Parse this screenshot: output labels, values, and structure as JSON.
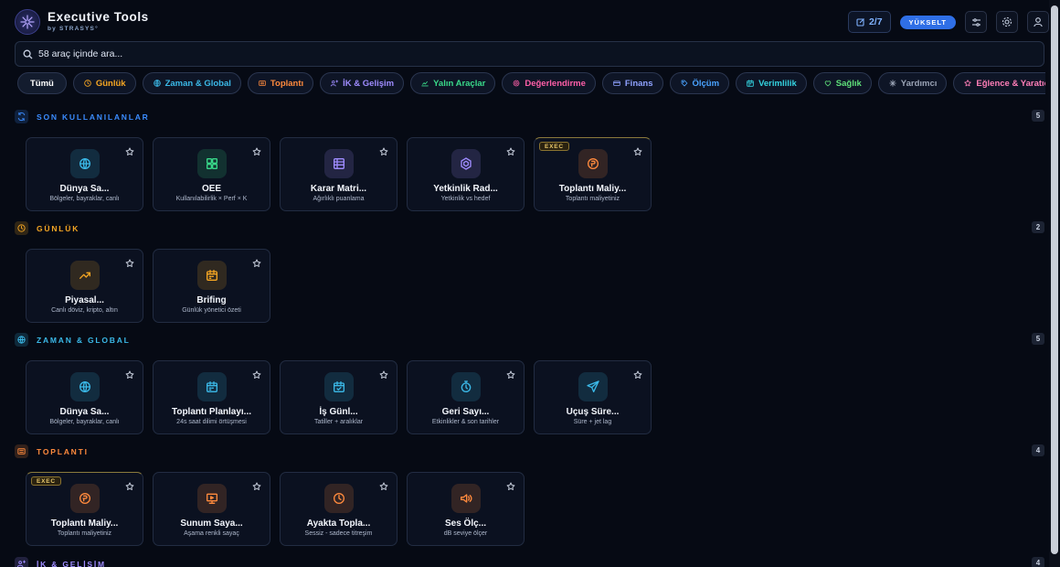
{
  "header": {
    "title": "Executive Tools",
    "subtitle": "by STRASYS°",
    "quota": "2/7",
    "upgrade_label": "YÜKSELT"
  },
  "search": {
    "placeholder": "58 araç içinde ara..."
  },
  "filters": [
    {
      "label": "Tümü",
      "color": "#ffffff",
      "icon": "none"
    },
    {
      "label": "Günlük",
      "color": "#f5a623",
      "icon": "clock-icon"
    },
    {
      "label": "Zaman & Global",
      "color": "#3bb9e8",
      "icon": "globe-icon"
    },
    {
      "label": "Toplantı",
      "color": "#ff8a3d",
      "icon": "meeting-icon"
    },
    {
      "label": "İK & Gelişim",
      "color": "#9f8cff",
      "icon": "people-icon"
    },
    {
      "label": "Yalın Araçlar",
      "color": "#39d98a",
      "icon": "chart-icon"
    },
    {
      "label": "Değerlendirme",
      "color": "#ff5fa8",
      "icon": "gear-icon"
    },
    {
      "label": "Finans",
      "color": "#8fa2ff",
      "icon": "wallet-icon"
    },
    {
      "label": "Ölçüm",
      "color": "#4aa3ff",
      "icon": "tag-icon"
    },
    {
      "label": "Verimlilik",
      "color": "#34d3e0",
      "icon": "calendar-icon"
    },
    {
      "label": "Sağlık",
      "color": "#5fe07a",
      "icon": "heart-icon"
    },
    {
      "label": "Yardımcı",
      "color": "#9aa3b5",
      "icon": "sparkle-icon"
    },
    {
      "label": "Eğlence & Yaratıcı",
      "color": "#ff7eb8",
      "icon": "star-icon"
    }
  ],
  "sections": [
    {
      "title": "SON KULLANILANLAR",
      "count": "5",
      "color": "#3b8cff",
      "icon": "refresh-icon",
      "tools": [
        {
          "name": "Dünya Sa...",
          "desc": "Bölgeler, bayraklar, canlı",
          "icon": "globe-icon",
          "color": "#3bb9e8",
          "exec": false
        },
        {
          "name": "OEE",
          "desc": "Kullanılabilirlik × Perf × K",
          "icon": "grid-icon",
          "color": "#39d98a",
          "exec": false
        },
        {
          "name": "Karar Matri...",
          "desc": "Ağırlıklı puanlama",
          "icon": "table-icon",
          "color": "#9f8cff",
          "exec": false
        },
        {
          "name": "Yetkinlik Rad...",
          "desc": "Yetkinlik vs hedef",
          "icon": "hexagon-icon",
          "color": "#9f8cff",
          "exec": false
        },
        {
          "name": "Toplantı Maliy...",
          "desc": "Toplantı maliyetiniz",
          "icon": "coin-icon",
          "color": "#ff8a3d",
          "exec": true
        }
      ]
    },
    {
      "title": "GÜNLÜK",
      "count": "2",
      "color": "#f5a623",
      "icon": "clock-icon",
      "tools": [
        {
          "name": "Piyasal...",
          "desc": "Canlı döviz, kripto, altın",
          "icon": "trend-icon",
          "color": "#f5a623",
          "exec": false
        },
        {
          "name": "Brifing",
          "desc": "Günlük yönetici özeti",
          "icon": "calendar-icon",
          "color": "#f5a623",
          "exec": false
        }
      ]
    },
    {
      "title": "ZAMAN & GLOBAL",
      "count": "5",
      "color": "#3bb9e8",
      "icon": "globe-icon",
      "tools": [
        {
          "name": "Dünya Sa...",
          "desc": "Bölgeler, bayraklar, canlı",
          "icon": "globe-icon",
          "color": "#3bb9e8",
          "exec": false
        },
        {
          "name": "Toplantı Planlayı...",
          "desc": "24s saat dilimi örtüşmesi",
          "icon": "calendar-icon",
          "color": "#3bb9e8",
          "exec": false
        },
        {
          "name": "İş Günl...",
          "desc": "Tatiller + aralıklar",
          "icon": "calendar-check-icon",
          "color": "#3bb9e8",
          "exec": false
        },
        {
          "name": "Geri Sayı...",
          "desc": "Etkinlikler & son tarihler",
          "icon": "stopwatch-icon",
          "color": "#3bb9e8",
          "exec": false
        },
        {
          "name": "Uçuş Süre...",
          "desc": "Süre + jet lag",
          "icon": "plane-icon",
          "color": "#3bb9e8",
          "exec": false
        }
      ]
    },
    {
      "title": "TOPLANTI",
      "count": "4",
      "color": "#ff8a3d",
      "icon": "meeting-icon",
      "tools": [
        {
          "name": "Toplantı Maliy...",
          "desc": "Toplantı maliyetiniz",
          "icon": "coin-icon",
          "color": "#ff8a3d",
          "exec": true
        },
        {
          "name": "Sunum Saya...",
          "desc": "Aşama renkli sayaç",
          "icon": "presentation-icon",
          "color": "#ff8a3d",
          "exec": false
        },
        {
          "name": "Ayakta Topla...",
          "desc": "Sessiz - sadece titreşim",
          "icon": "clock-icon",
          "color": "#ff8a3d",
          "exec": false
        },
        {
          "name": "Ses Ölç...",
          "desc": "dB seviye ölçer",
          "icon": "speaker-icon",
          "color": "#ff8a3d",
          "exec": false
        }
      ]
    },
    {
      "title": "İK & GELİŞİM",
      "count": "4",
      "color": "#9f8cff",
      "icon": "people-icon",
      "tools": []
    }
  ],
  "exec_badge": "EXEC"
}
